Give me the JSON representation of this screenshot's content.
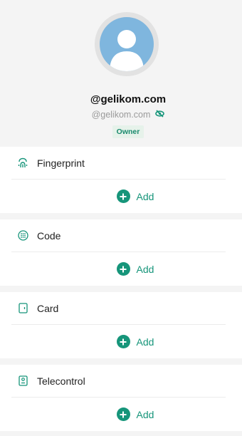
{
  "profile": {
    "name": "@gelikom.com",
    "email": "@gelikom.com",
    "role_badge": "Owner"
  },
  "sections": [
    {
      "title": "Fingerprint",
      "icon": "fingerprint-icon",
      "add_label": "Add"
    },
    {
      "title": "Code",
      "icon": "keypad-icon",
      "add_label": "Add"
    },
    {
      "title": "Card",
      "icon": "card-icon",
      "add_label": "Add"
    },
    {
      "title": "Telecontrol",
      "icon": "remote-icon",
      "add_label": "Add"
    }
  ],
  "colors": {
    "accent": "#16957a",
    "avatar": "#7fb6de"
  }
}
